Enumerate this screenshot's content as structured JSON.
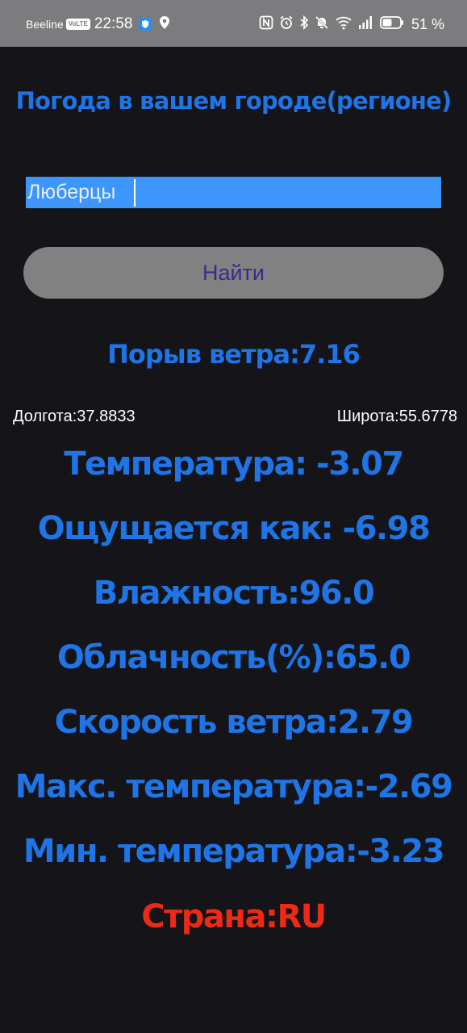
{
  "status_bar": {
    "carrier": "Beeline",
    "volte": "VoLTE",
    "time": "22:58",
    "battery_percent": "51 %",
    "icons": [
      "shield-icon",
      "location-icon",
      "nfc-icon",
      "alarm-icon",
      "bluetooth-icon",
      "mute-icon",
      "wifi-icon",
      "signal-icon",
      "battery-icon"
    ]
  },
  "app": {
    "title": "Погода в вашем городе(регионе)",
    "search": {
      "value": "Люберцы",
      "button_label": "Найти"
    },
    "weather": {
      "wind_gust": "Порыв ветра:7.16",
      "longitude": "Долгота:37.8833",
      "latitude": "Широта:55.6778",
      "temperature": "Температура: -3.07",
      "feels_like": "Ощущается как: -6.98",
      "humidity": "Влажность:96.0",
      "cloudiness": "Облачность(%):65.0",
      "wind_speed": "Скорость ветра:2.79",
      "temp_max": "Макс. температура:-2.69",
      "temp_min": "Мин. температура:-3.23",
      "country": "Страна:RU"
    }
  },
  "colors": {
    "background": "#151419",
    "accent_text": "#1f74e6",
    "input_bg": "#3c96fb",
    "button_bg": "#818181",
    "button_text": "#3b2a8a",
    "country_text": "#ec2a16",
    "status_bar_bg": "#7c7c7e"
  }
}
